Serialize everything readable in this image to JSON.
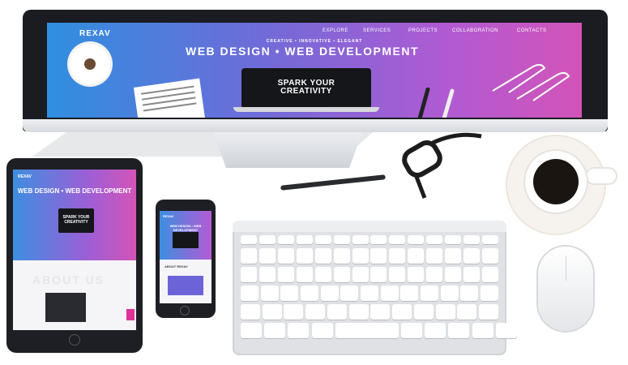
{
  "desktop": {
    "brand": "REXAV",
    "nav": [
      "EXPLORE",
      "SERVICES",
      "PROJECTS",
      "COLLABORATION",
      "CONTACTS"
    ],
    "tagline": "CREATIVE • INNOVATIVE • ELEGANT",
    "headline": "WEB DESIGN • WEB DEVELOPMENT",
    "cta_line1": "SPARK YOUR",
    "cta_line2": "CREATIVITY"
  },
  "tablet": {
    "brand": "REXAV",
    "headline": "WEB DESIGN • WEB DEVELOPMENT",
    "cta_line1": "SPARK YOUR",
    "cta_line2": "CREATIVITY",
    "about": "ABOUT US"
  },
  "phone": {
    "brand": "REXAV",
    "headline": "WEB DESIGN • WEB DEVELOPMENT",
    "about": "ABOUT REXAV"
  },
  "colors": {
    "gradient_start": "#2f8fe0",
    "gradient_mid": "#b15ad2",
    "gradient_end": "#d354b8",
    "device_frame": "#1a1c22"
  }
}
